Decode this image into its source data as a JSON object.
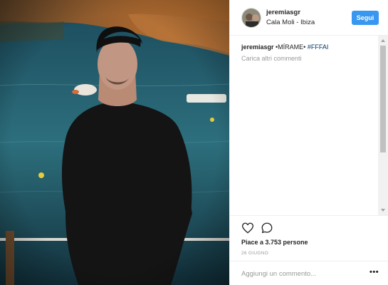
{
  "post": {
    "username": "jeremiasgr",
    "location": "Cala Moli - Ibiza",
    "follow_label": "Segui",
    "caption": {
      "username": "jeremiasgr",
      "text": " •MÍRAME• ",
      "hashtag": "#FFFAI"
    },
    "load_more_label": "Carica altri commenti",
    "likes_label": "Piace a 3.753 persone",
    "date_label": "26 GIUGNO",
    "comment_placeholder": "Aggiungi un commento...",
    "more_options_label": "•••"
  },
  "icons": {
    "like": "heart-outline-icon",
    "comment": "speech-bubble-outline-icon"
  },
  "colors": {
    "follow_button": "#3897f0",
    "hashtag": "#003569",
    "muted_text": "#999999"
  }
}
